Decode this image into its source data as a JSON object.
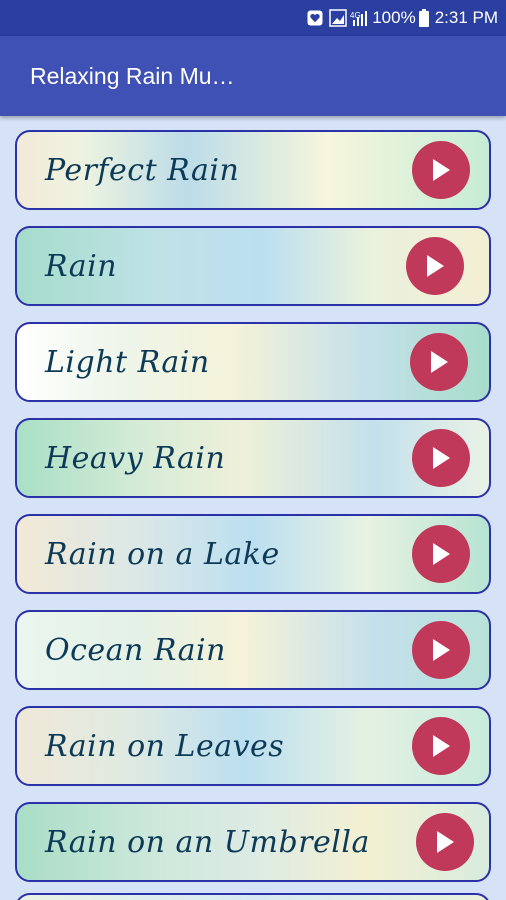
{
  "status_bar": {
    "battery": "100%",
    "time": "2:31 PM"
  },
  "app_bar": {
    "title": "Relaxing Rain Mu…"
  },
  "sounds": [
    {
      "label": "Perfect Rain"
    },
    {
      "label": "Rain"
    },
    {
      "label": "Light Rain"
    },
    {
      "label": "Heavy Rain"
    },
    {
      "label": "Rain on a Lake"
    },
    {
      "label": "Ocean Rain"
    },
    {
      "label": "Rain on Leaves"
    },
    {
      "label": "Rain on an Umbrella"
    }
  ],
  "colors": {
    "status_bar": "#2a3fa0",
    "app_bar": "#3f51b5",
    "background": "#d6e3f7",
    "card_border": "#2b31a6",
    "play_button": "#c0395a",
    "label_text": "#0d3b57"
  },
  "icons": {
    "play": "play-icon",
    "notification": "heart-notification-icon",
    "signal": "signal-icon",
    "battery": "battery-icon"
  }
}
